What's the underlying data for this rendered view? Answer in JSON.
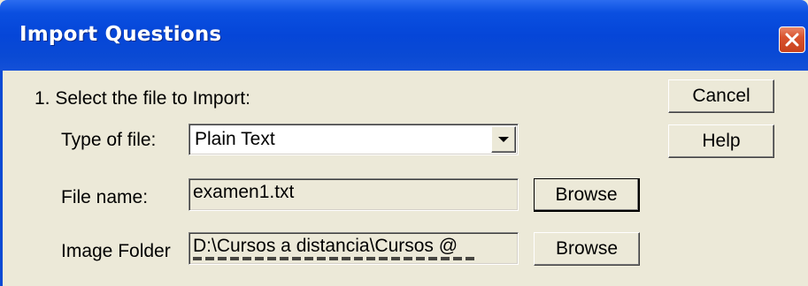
{
  "window": {
    "title": "Import Questions"
  },
  "step": {
    "label": "1. Select the file to Import:"
  },
  "file_type": {
    "label": "Type of file:",
    "selected": "Plain Text"
  },
  "file_name": {
    "label": "File name:",
    "value": "examen1.txt",
    "browse_label": "Browse"
  },
  "image_folder": {
    "label": "Image Folder",
    "value_line1": "D:\\Cursos a distancia\\Cursos @",
    "browse_label": "Browse"
  },
  "actions": {
    "cancel_label": "Cancel",
    "help_label": "Help"
  },
  "colors": {
    "titlebar": "#0546d8",
    "dialog_face": "#ece9d8",
    "close_button": "#d9532e"
  },
  "icons": {
    "close": "close-icon",
    "dropdown": "chevron-down-icon"
  }
}
